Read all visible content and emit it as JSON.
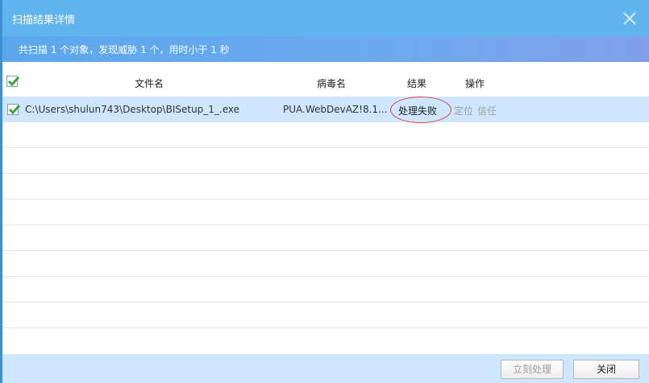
{
  "dialog": {
    "title": "扫描结果详情",
    "close_icon": "close-icon",
    "summary": "共扫描 1 个对象，发现威胁 1 个，用时小于 1 秒"
  },
  "table": {
    "headers": {
      "filename": "文件名",
      "virus_name": "病毒名",
      "result": "结果",
      "action": "操作"
    },
    "header_checked": true,
    "rows": [
      {
        "checked": true,
        "path": "C:\\Users\\shulun743\\Desktop\\BISetup_1_.exe",
        "virus": "PUA.WebDevAZ!8.1...",
        "result": "处理失败",
        "locate": "定位",
        "trust": "信任"
      }
    ]
  },
  "footer": {
    "process_now": "立刻处理",
    "close": "关闭"
  },
  "colors": {
    "titlebar": "#60b5ef",
    "summary_bar": "#6ba9ee",
    "selected_row": "#cfe6ff",
    "footer": "#cfe6ff",
    "check": "#3aa33a",
    "annotation_circle": "#e04040"
  }
}
